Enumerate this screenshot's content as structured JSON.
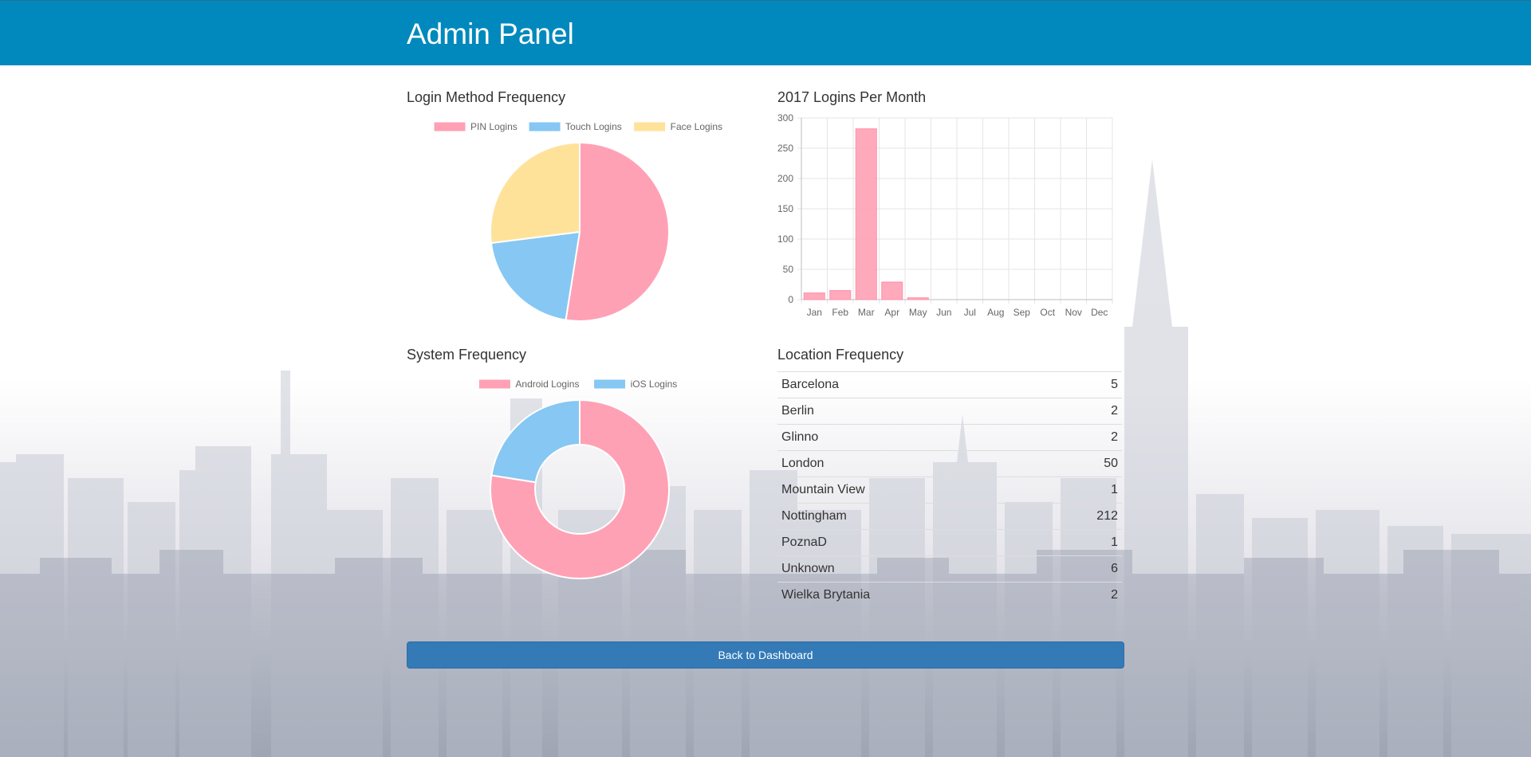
{
  "header": {
    "title": "Admin Panel"
  },
  "sections": {
    "login_method": "Login Method Frequency",
    "logins_per_month": "2017 Logins Per Month",
    "system": "System Frequency",
    "location": "Location Frequency"
  },
  "colors": {
    "header_bg": "#0189bd",
    "pink": "#ffa1b5",
    "blue": "#86c7f3",
    "yellow": "#ffe29a",
    "button": "#337ab7"
  },
  "chart_data": [
    {
      "type": "pie",
      "legend": [
        "PIN Logins",
        "Touch Logins",
        "Face Logins"
      ],
      "values": [
        52.5,
        20.5,
        27
      ],
      "colors": [
        "#ffa1b5",
        "#86c7f3",
        "#ffe29a"
      ],
      "legend_position": "top"
    },
    {
      "type": "bar",
      "categories": [
        "Jan",
        "Feb",
        "Mar",
        "Apr",
        "May",
        "Jun",
        "Jul",
        "Aug",
        "Sep",
        "Oct",
        "Nov",
        "Dec"
      ],
      "values": [
        11,
        15,
        282,
        29,
        3,
        0,
        0,
        0,
        0,
        0,
        0,
        0
      ],
      "yticks": [
        "0",
        "50",
        "100",
        "150",
        "200",
        "250",
        "300"
      ],
      "ylim": [
        0,
        300
      ],
      "grid": true,
      "color": "#ffa1b5"
    },
    {
      "type": "doughnut",
      "legend": [
        "Android Logins",
        "iOS Logins"
      ],
      "values": [
        77.5,
        22.5
      ],
      "colors": [
        "#ffa1b5",
        "#86c7f3"
      ],
      "legend_position": "top"
    }
  ],
  "locations": [
    {
      "name": "Barcelona",
      "count": "5"
    },
    {
      "name": "Berlin",
      "count": "2"
    },
    {
      "name": "Glinno",
      "count": "2"
    },
    {
      "name": "London",
      "count": "50"
    },
    {
      "name": "Mountain View",
      "count": "1"
    },
    {
      "name": "Nottingham",
      "count": "212"
    },
    {
      "name": "PoznaD",
      "count": "1"
    },
    {
      "name": "Unknown",
      "count": "6"
    },
    {
      "name": "Wielka Brytania",
      "count": "2"
    }
  ],
  "footer": {
    "back_label": "Back to Dashboard"
  }
}
